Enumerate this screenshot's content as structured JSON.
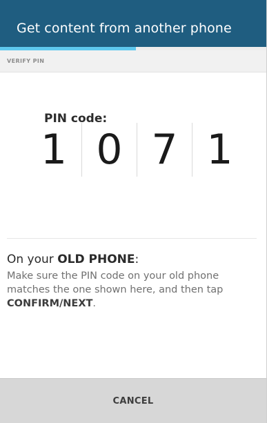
{
  "header": {
    "title": "Get content from another phone",
    "background_color": "#1f5d80"
  },
  "progress": {
    "fraction": 0.51,
    "fill_color": "#5ec8ee"
  },
  "section": {
    "label": "VERIFY PIN"
  },
  "pin": {
    "label": "PIN code:",
    "digits": [
      "1",
      "0",
      "7",
      "1"
    ]
  },
  "instructions": {
    "heading_prefix": "On your ",
    "heading_emphasis": "OLD PHONE",
    "heading_suffix": ":",
    "body_text": "Make sure the PIN code on your old phone matches the one shown here, and then tap ",
    "body_emphasis": "CONFIRM/NEXT",
    "body_end": "."
  },
  "footer": {
    "cancel_label": "CANCEL"
  }
}
